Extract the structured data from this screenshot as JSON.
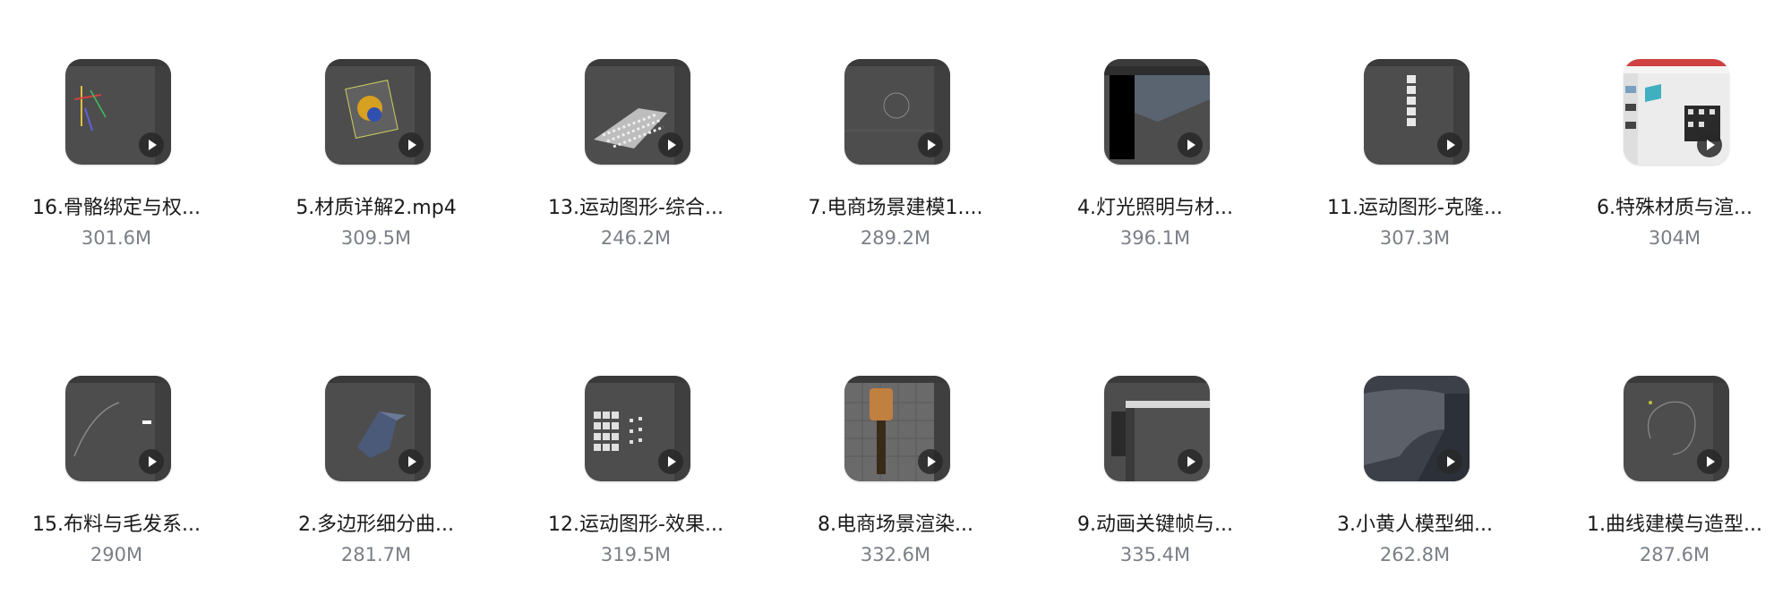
{
  "files": [
    {
      "name": "16.骨骼绑定与权...",
      "size": "301.6M",
      "thumb": "dark"
    },
    {
      "name": "5.材质详解2.mp4",
      "size": "309.5M",
      "thumb": "dark"
    },
    {
      "name": "13.运动图形-综合...",
      "size": "246.2M",
      "thumb": "dark"
    },
    {
      "name": "7.电商场景建模1....",
      "size": "289.2M",
      "thumb": "dark"
    },
    {
      "name": "4.灯光照明与材...",
      "size": "396.1M",
      "thumb": "dark"
    },
    {
      "name": "11.运动图形-克隆...",
      "size": "307.3M",
      "thumb": "dark"
    },
    {
      "name": "6.特殊材质与渲...",
      "size": "304M",
      "thumb": "light"
    },
    {
      "name": "15.布料与毛发系...",
      "size": "290M",
      "thumb": "dark"
    },
    {
      "name": "2.多边形细分曲...",
      "size": "281.7M",
      "thumb": "dark"
    },
    {
      "name": "12.运动图形-效果...",
      "size": "319.5M",
      "thumb": "dark"
    },
    {
      "name": "8.电商场景渲染...",
      "size": "332.6M",
      "thumb": "dark"
    },
    {
      "name": "9.动画关键帧与...",
      "size": "335.4M",
      "thumb": "dark"
    },
    {
      "name": "3.小黄人模型细...",
      "size": "262.8M",
      "thumb": "dark"
    },
    {
      "name": "1.曲线建模与造型...",
      "size": "287.6M",
      "thumb": "dark"
    }
  ],
  "icons": {
    "play": "play-icon"
  }
}
